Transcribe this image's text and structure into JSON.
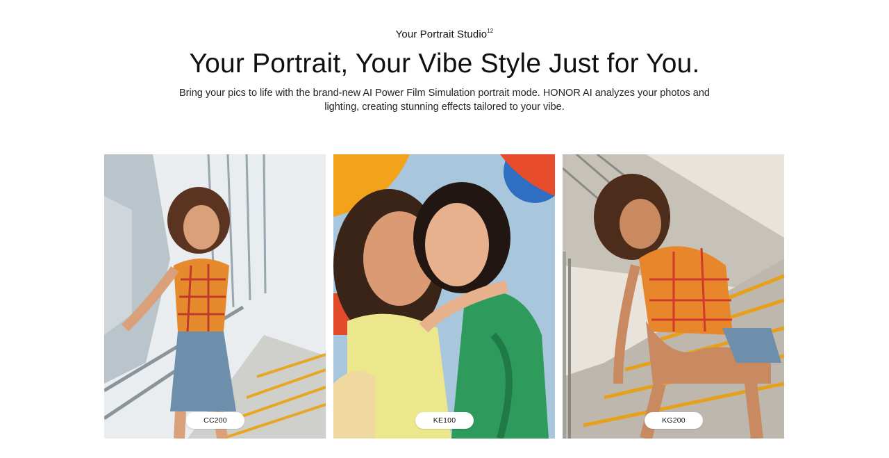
{
  "section": {
    "eyebrow": "Your Portrait Studio",
    "eyebrow_sup": "12",
    "headline": "Your Portrait, Your Vibe Style Just for You.",
    "description_line1": "Bring your pics to life with the brand-new AI Power Film Simulation portrait mode. HONOR AI analyzes your photos and",
    "description_line2": "lighting, creating stunning effects tailored to your vibe."
  },
  "cards": [
    {
      "label": "CC200",
      "image": "portrait-photo-woman-on-stairs"
    },
    {
      "label": "KE100",
      "image": "portrait-photo-two-friends-hugging"
    },
    {
      "label": "KG200",
      "image": "portrait-photo-woman-sitting-on-stairs"
    }
  ]
}
